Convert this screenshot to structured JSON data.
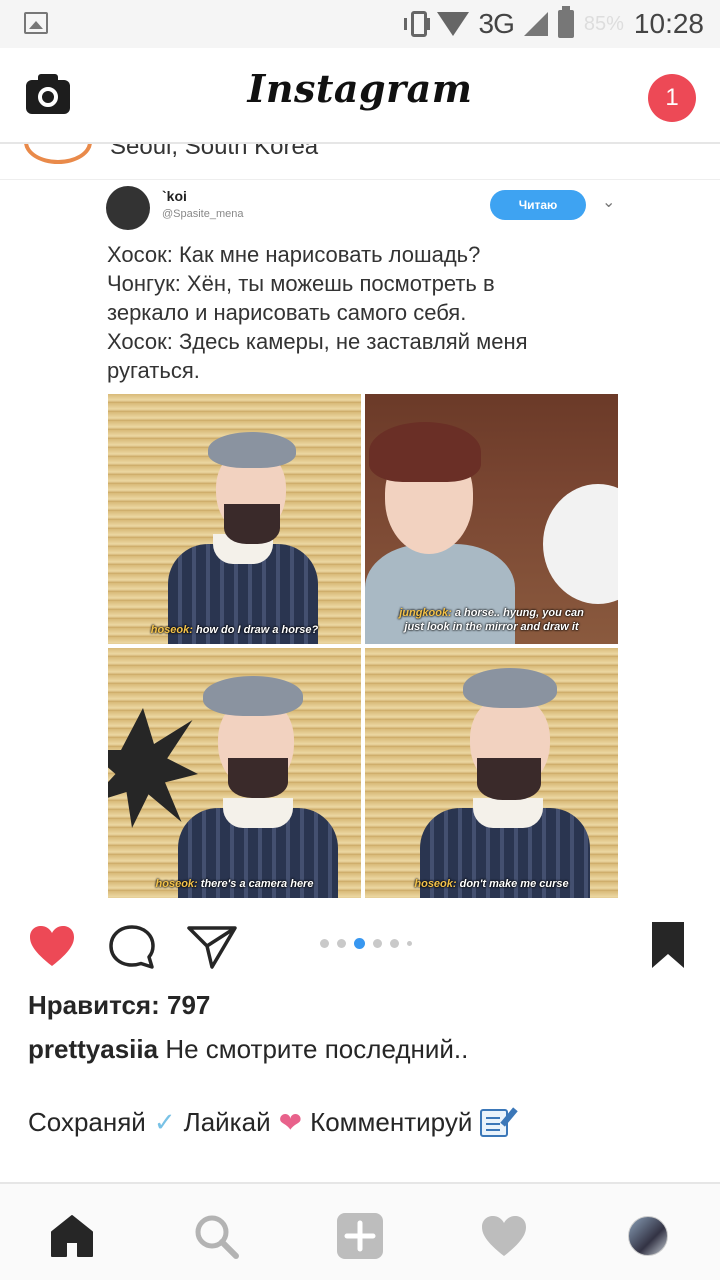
{
  "status_bar": {
    "network": "3G",
    "battery_percent": "85%",
    "time": "10:28"
  },
  "header": {
    "brand": "Instagram",
    "notification_count": "1",
    "location": "Seoul, South Korea"
  },
  "tweet": {
    "name": "`koi",
    "handle": "@Spasite_mena",
    "follow_label": "Читаю",
    "text_lines": [
      "Хосок: Как мне нарисовать лошадь?",
      "Чонгук: Хён, ты можешь посмотреть в",
      "зеркало и нарисовать самого себя.",
      "Хосок: Здесь камеры, не заставляй меня",
      "ругаться."
    ],
    "panels": [
      {
        "speaker": "hoseok:",
        "line": " how do I draw a horse?"
      },
      {
        "speaker": "jungkook:",
        "line": " a horse.. hyung, you can",
        "line2": "just look in the mirror and draw it"
      },
      {
        "speaker": "hoseok:",
        "line": " there's a camera here"
      },
      {
        "speaker": "hoseok:",
        "line": " don't make me curse"
      }
    ]
  },
  "carousel": {
    "count": 6,
    "active_index": 2
  },
  "post": {
    "likes": "Нравится: 797",
    "username": "prettyasiia",
    "caption": "Не смотрите последний..",
    "promo": {
      "save": "Сохраняй",
      "like": "Лайкай",
      "comment": "Комментируй"
    }
  },
  "icons": {
    "like": "heart-icon",
    "comment": "comment-icon",
    "share": "share-icon",
    "save": "bookmark-icon",
    "nav": [
      "home-icon",
      "search-icon",
      "add-icon",
      "activity-icon",
      "profile-avatar"
    ]
  },
  "colors": {
    "like_red": "#ed4956",
    "carousel_active": "#3897f0",
    "follow_blue": "#3ea3f2"
  }
}
